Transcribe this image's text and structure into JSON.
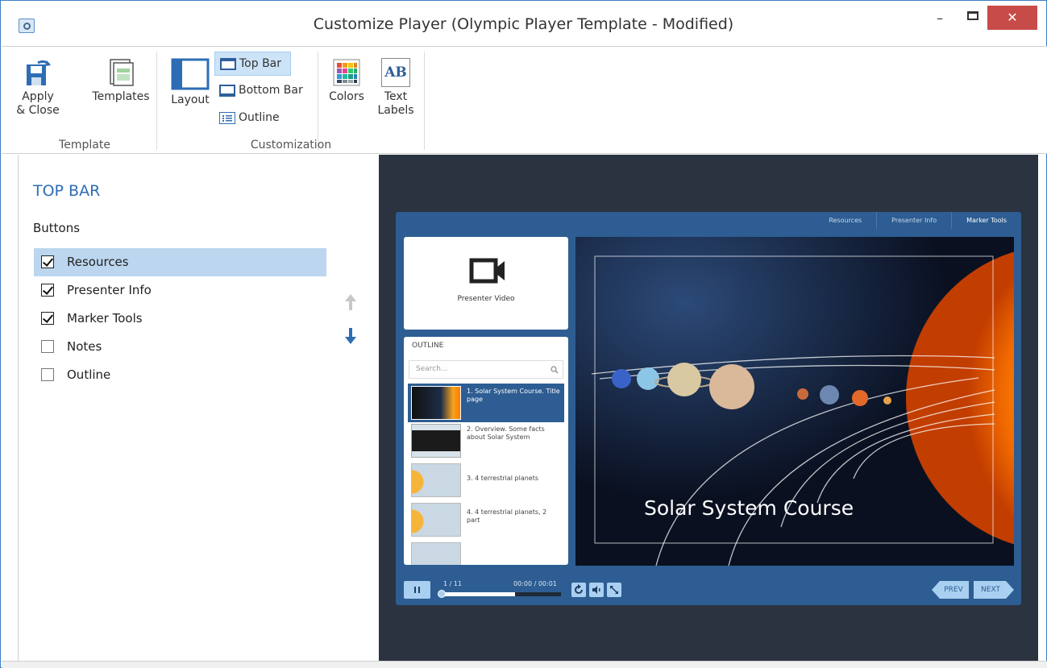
{
  "window": {
    "title": "Customize Player (Olympic Player Template - Modified)",
    "minimize_glyph": "–",
    "close_glyph": "✕"
  },
  "ribbon": {
    "apply_close_line1": "Apply",
    "apply_close_line2": "& Close",
    "templates_label": "Templates",
    "template_group": "Template",
    "layout_label": "Layout",
    "top_bar_label": "Top Bar",
    "bottom_bar_label": "Bottom Bar",
    "outline_label": "Outline",
    "colors_label": "Colors",
    "text_labels_line1": "Text",
    "text_labels_line2": "Labels",
    "text_labels_icon_text": "AB",
    "customization_group": "Customization"
  },
  "panel": {
    "title": "TOP BAR",
    "buttons_label": "Buttons",
    "items": [
      {
        "label": "Resources",
        "checked": true,
        "selected": true
      },
      {
        "label": "Presenter Info",
        "checked": true,
        "selected": false
      },
      {
        "label": "Marker Tools",
        "checked": true,
        "selected": false
      },
      {
        "label": "Notes",
        "checked": false,
        "selected": false
      },
      {
        "label": "Outline",
        "checked": false,
        "selected": false
      }
    ]
  },
  "player": {
    "top_tabs": [
      "Resources",
      "Presenter Info",
      "Marker Tools"
    ],
    "presenter_video_label": "Presenter Video",
    "outline_title": "OUTLINE",
    "search_placeholder": "Search...",
    "outline_items": [
      "1. Solar System Course. Title page",
      "2. Overview. Some facts about Solar System",
      "3. 4 terrestrial planets",
      "4. 4 terrestrial planets, 2 part"
    ],
    "slide_title": "Solar System Course",
    "slide_counter": "1 / 11",
    "time": "00:00 / 00:01",
    "progress_fraction": 0.62,
    "prev_label": "PREV",
    "next_label": "NEXT"
  },
  "colors": {
    "accent": "#2e6db4",
    "player_bar": "#2d5d92",
    "dark_bg": "#2b3340",
    "selection": "#bcd6ef",
    "close_button": "#c74b49"
  }
}
